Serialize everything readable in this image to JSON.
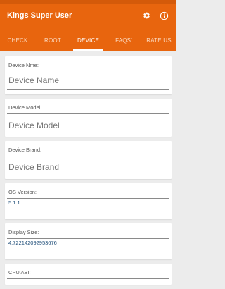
{
  "app": {
    "title": "Kings Super User",
    "accent_color": "#e8650e",
    "icons": {
      "settings": "gear-icon",
      "info": "info-icon"
    }
  },
  "tabs": [
    {
      "label": "CHECK",
      "active": false
    },
    {
      "label": "ROOT",
      "active": false
    },
    {
      "label": "DEVICE",
      "active": true
    },
    {
      "label": "FAQS'",
      "active": false
    },
    {
      "label": "RATE US",
      "active": false
    }
  ],
  "fields": {
    "device_name": {
      "label": "Device Nme:",
      "placeholder": "Device Name"
    },
    "device_model": {
      "label": "Device Model:",
      "placeholder": "Device Model"
    },
    "device_brand": {
      "label": "Device Brand:",
      "placeholder": "Device Brand"
    },
    "os_version": {
      "label": "OS Version:",
      "value": "5.1.1"
    },
    "display_size": {
      "label": "Display Size:",
      "value": "4.722142092953676"
    },
    "cpu_abi": {
      "label": "CPU ABI:"
    }
  }
}
